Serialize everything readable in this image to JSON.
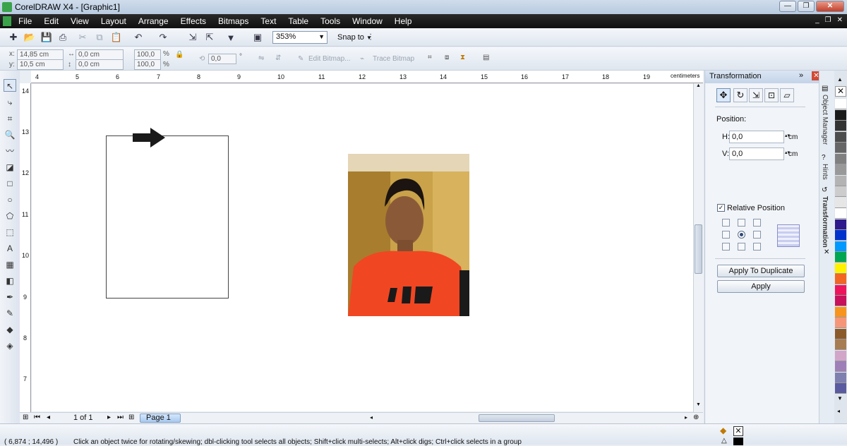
{
  "window": {
    "title": "CorelDRAW X4 - [Graphic1]"
  },
  "menu": {
    "items": [
      "File",
      "Edit",
      "View",
      "Layout",
      "Arrange",
      "Effects",
      "Bitmaps",
      "Text",
      "Table",
      "Tools",
      "Window",
      "Help"
    ]
  },
  "toolbar": {
    "zoom": "353%",
    "snap_to": "Snap to"
  },
  "property_bar": {
    "x_label": "x:",
    "x_value": "14,85 cm",
    "y_label": "y:",
    "y_value": "10,5 cm",
    "width": "0,0 cm",
    "height": "0,0 cm",
    "scale_x": "100,0",
    "scale_y": "100,0",
    "percent": "%",
    "angle": "0,0",
    "degree": "°",
    "edit_bitmap": "Edit Bitmap...",
    "trace_bitmap": "Trace Bitmap"
  },
  "ruler": {
    "h_ticks": [
      "4",
      "5",
      "6",
      "7",
      "8",
      "9",
      "10",
      "11",
      "12",
      "13",
      "14",
      "15",
      "16",
      "17",
      "18",
      "19"
    ],
    "v_ticks": [
      "14",
      "13",
      "12",
      "11",
      "10",
      "9",
      "8",
      "7"
    ],
    "units": "centimeters"
  },
  "page_nav": {
    "counter": "1 of 1",
    "tab": "Page 1"
  },
  "docker": {
    "title": "Transformation",
    "position_label": "Position:",
    "h_label": "H:",
    "h_value": "0,0",
    "v_label": "V:",
    "v_value": "0,0",
    "unit": "cm",
    "relative_position": "Relative Position",
    "apply_duplicate": "Apply To Duplicate",
    "apply": "Apply"
  },
  "side_tabs": {
    "object_manager": "Object Manager",
    "hints": "Hints",
    "transformation": "Transformation"
  },
  "status": {
    "coords": "( 6,874 ; 14,496 )",
    "hint": "Click an object twice for rotating/skewing; dbl-clicking tool selects all objects; Shift+click multi-selects; Alt+click digs; Ctrl+click selects in a group"
  },
  "palette": {
    "colors": [
      "#ffffff",
      "#1a1a1a",
      "#333333",
      "#4d4d4d",
      "#666666",
      "#808080",
      "#999999",
      "#b3b3b3",
      "#cccccc",
      "#e6e6e6",
      "#ffffff",
      "#2e1a8c",
      "#0033cc",
      "#0099ff",
      "#00a651",
      "#fff200",
      "#f26522",
      "#ed145b",
      "#c8105b",
      "#f7941d",
      "#f69679",
      "#8b5a2b",
      "#a67c52",
      "#d1a6c9",
      "#9e7fb8",
      "#7f7fb0",
      "#5a5aa0"
    ]
  }
}
